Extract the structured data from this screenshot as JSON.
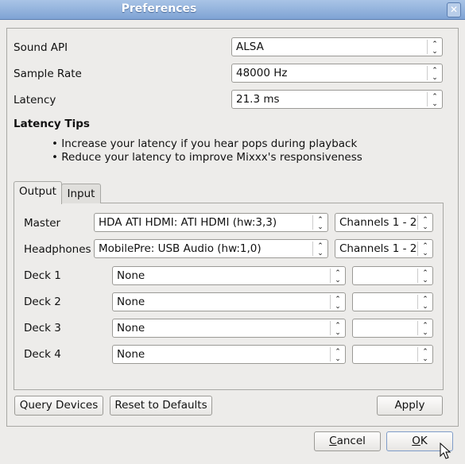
{
  "window": {
    "title": "Preferences",
    "close_icon": "close-icon"
  },
  "settings": [
    {
      "label": "Sound API",
      "value": "ALSA"
    },
    {
      "label": "Sample Rate",
      "value": "48000 Hz"
    },
    {
      "label": "Latency",
      "value": "21.3 ms"
    }
  ],
  "tips": {
    "heading": "Latency Tips",
    "items": [
      "• Increase your latency if you hear pops during playback",
      "• Reduce your latency to improve Mixxx's responsiveness"
    ]
  },
  "tabs": [
    {
      "label": "Output",
      "active": true
    },
    {
      "label": "Input",
      "active": false
    }
  ],
  "outputs": [
    {
      "label": "Master",
      "device": "HDA ATI HDMI: ATI HDMI (hw:3,3)",
      "channels": "Channels 1 - 2"
    },
    {
      "label": "Headphones",
      "device": "MobilePre: USB Audio (hw:1,0)",
      "channels": "Channels 1 - 2"
    },
    {
      "label": "Deck 1",
      "device": "None",
      "channels": ""
    },
    {
      "label": "Deck 2",
      "device": "None",
      "channels": ""
    },
    {
      "label": "Deck 3",
      "device": "None",
      "channels": ""
    },
    {
      "label": "Deck 4",
      "device": "None",
      "channels": ""
    }
  ],
  "buttons": {
    "query": "Query Devices",
    "reset": "Reset to Defaults",
    "apply": "Apply",
    "cancel_pre": "",
    "cancel_u": "C",
    "cancel_post": "ancel",
    "ok_u": "O",
    "ok_post": "K"
  }
}
